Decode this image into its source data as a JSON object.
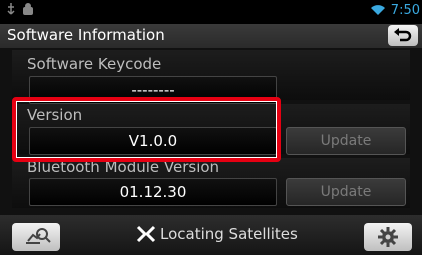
{
  "statusbar": {
    "clock": "7:50",
    "icons": [
      "usb-icon",
      "android-icon",
      "wifi-icon"
    ]
  },
  "header": {
    "title": "Software Information",
    "back_icon": "back-arrow-icon"
  },
  "sections": [
    {
      "label": "Software Keycode",
      "value": "--------"
    },
    {
      "label": "Version",
      "value": "V1.0.0",
      "button": "Update"
    },
    {
      "label": "Bluetooth Module Version",
      "value": "01.12.30",
      "button": "Update"
    }
  ],
  "bottom": {
    "status_text": "Locating Satellites",
    "left_icon": "user-search-icon",
    "right_icon": "settings-gear-icon"
  },
  "colors": {
    "accent": "#3aa9e0",
    "highlight": "#e60012",
    "disabled_text": "#7a7a7a"
  }
}
